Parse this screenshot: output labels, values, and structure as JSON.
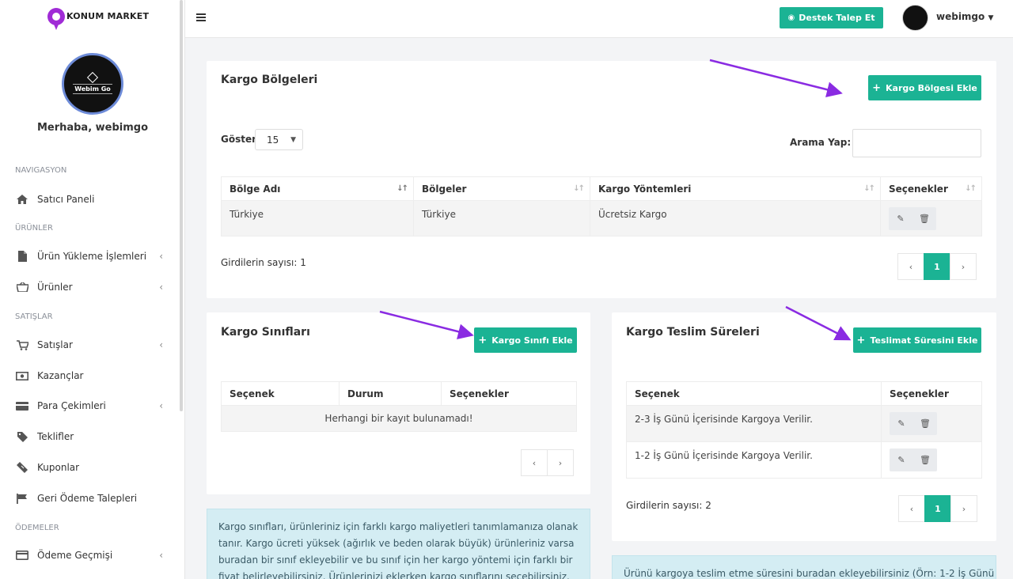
{
  "brand": {
    "name": "KONUM MARKET"
  },
  "sidebar": {
    "avatar_text": "Webim Go",
    "greeting": "Merhaba, webimgo",
    "sections": {
      "nav": "NAVIGASYON",
      "products": "ÜRÜNLER",
      "sales": "SATIŞLAR",
      "payments": "ÖDEMELER"
    },
    "items": [
      {
        "label": "Satıcı Paneli",
        "icon": "home-icon"
      },
      {
        "label": "Ürün Yükleme İşlemleri",
        "icon": "file-icon"
      },
      {
        "label": "Ürünler",
        "icon": "basket-icon"
      },
      {
        "label": "Satışlar",
        "icon": "cart-icon"
      },
      {
        "label": "Kazançlar",
        "icon": "money-icon"
      },
      {
        "label": "Para Çekimleri",
        "icon": "card-icon"
      },
      {
        "label": "Teklifler",
        "icon": "tag-icon"
      },
      {
        "label": "Kuponlar",
        "icon": "ticket-icon"
      },
      {
        "label": "Geri Ödeme Talepleri",
        "icon": "flag-icon"
      },
      {
        "label": "Ödeme Geçmişi",
        "icon": "credit-card-icon"
      }
    ]
  },
  "topbar": {
    "support_button": "Destek Talep Et",
    "username": "webimgo"
  },
  "regions": {
    "title": "Kargo Bölgeleri",
    "add_button": "Kargo Bölgesi Ekle",
    "show_label": "Göster",
    "page_size": "15",
    "search_label": "Arama Yap:",
    "search_value": "",
    "columns": [
      "Bölge Adı",
      "Bölgeler",
      "Kargo Yöntemleri",
      "Seçenekler"
    ],
    "rows": [
      {
        "name": "Türkiye",
        "regions": "Türkiye",
        "methods": "Ücretsiz Kargo"
      }
    ],
    "count": "Girdilerin sayısı: 1",
    "pager": {
      "prev": "‹",
      "page": "1",
      "next": "›"
    }
  },
  "classes": {
    "title": "Kargo Sınıfları",
    "add_button": "Kargo Sınıfı Ekle",
    "columns": [
      "Seçenek",
      "Durum",
      "Seçenekler"
    ],
    "empty": "Herhangi bir kayıt bulunamadı!",
    "pager": {
      "prev": "‹",
      "next": "›"
    },
    "info": "Kargo sınıfları, ürünleriniz için farklı kargo maliyetleri tanımlamanıza olanak tanır. Kargo ücreti yüksek (ağırlık ve beden olarak büyük) ürünleriniz varsa buradan bir sınıf ekleyebilir ve bu sınıf için her kargo yöntemi için farklı bir fiyat belirleyebilirsiniz. Ürünlerinizi eklerken kargo sınıflarını seçebilirsiniz."
  },
  "delivery": {
    "title": "Kargo Teslim Süreleri",
    "add_button": "Teslimat Süresini Ekle",
    "columns": [
      "Seçenek",
      "Seçenekler"
    ],
    "rows": [
      {
        "option": "2-3 İş Günü İçerisinde Kargoya Verilir."
      },
      {
        "option": "1-2 İş Günü İçerisinde Kargoya Verilir."
      }
    ],
    "count": "Girdilerin sayısı: 2",
    "pager": {
      "prev": "‹",
      "page": "1",
      "next": "›"
    },
    "info": "Ürünü kargoya teslim etme süresini buradan ekleyebilirsiniz (Örn: 1-2 İş Günü"
  },
  "colors": {
    "accent": "#1bb394",
    "arrow": "#8a2be2"
  }
}
